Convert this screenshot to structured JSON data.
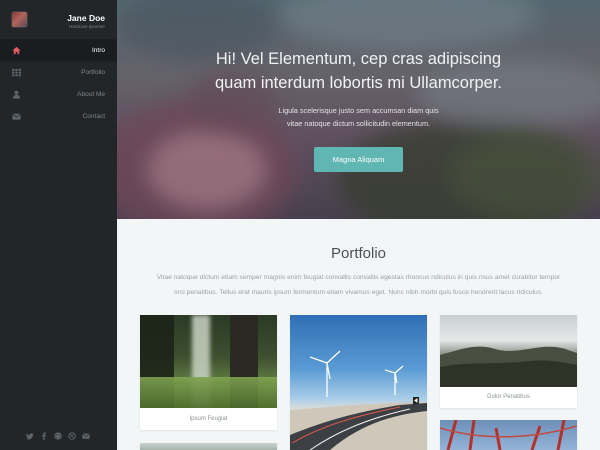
{
  "profile": {
    "name": "Jane Doe",
    "subtitle": "Hardcore Ipsumer"
  },
  "nav": {
    "items": [
      {
        "label": "Intro",
        "icon": "home-icon",
        "active": true
      },
      {
        "label": "Portfolio",
        "icon": "grid-icon",
        "active": false
      },
      {
        "label": "About Me",
        "icon": "user-icon",
        "active": false
      },
      {
        "label": "Contact",
        "icon": "envelope-icon",
        "active": false
      }
    ]
  },
  "social": [
    "twitter-icon",
    "facebook-icon",
    "github-icon",
    "dribbble-icon",
    "email-icon"
  ],
  "hero": {
    "title_line1": "Hi! Vel Elementum, cep cras adipiscing",
    "title_line2": "quam interdum lobortis mi Ullamcorper.",
    "text_line1": "Ligula scelerisque justo sem accumsan diam quis",
    "text_line2": "vitae natoque dictum sollicitudin elementum.",
    "button_label": "Magna Aliquam"
  },
  "portfolio": {
    "title": "Portfolio",
    "intro_line1": "Vitae natoque dictum etiam semper magnis enim feugiat convallis convallis egestas rhoncus ridiculus in quis risus amet curabitur tempor",
    "intro_line2": "orci penatibus. Tellus erat mauris ipsum fermentum etiam vivamus eget. Nunc nibh morbi quis fusce hendrerit lacus ridiculus.",
    "items": [
      {
        "caption": "Ipsum Feugiat"
      },
      {
        "caption": ""
      },
      {
        "caption": "Dolor Penatibus"
      }
    ]
  },
  "colors": {
    "sidebar_bg": "#222629",
    "accent": "#e85a65",
    "button": "#5fb6b3",
    "page_bg": "#f3f6f6"
  }
}
